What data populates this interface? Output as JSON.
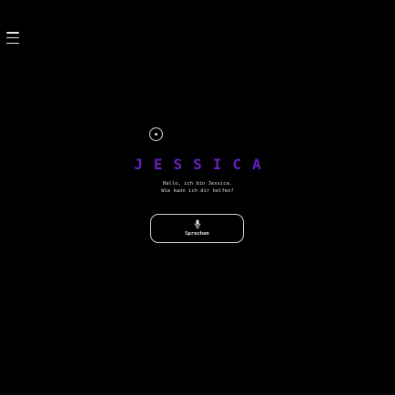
{
  "app": {
    "name": "JESSICA",
    "accent_color": "#6a1fc4"
  },
  "header": {
    "menu_icon": "hamburger-menu-icon"
  },
  "status": {
    "icon": "radio-dot-icon"
  },
  "greeting": {
    "line1": "Hallo, ich bin Jessica.",
    "line2": "Wie kann ich dir helfen?"
  },
  "speak_button": {
    "label": "Sprechen",
    "icon": "microphone-icon"
  }
}
